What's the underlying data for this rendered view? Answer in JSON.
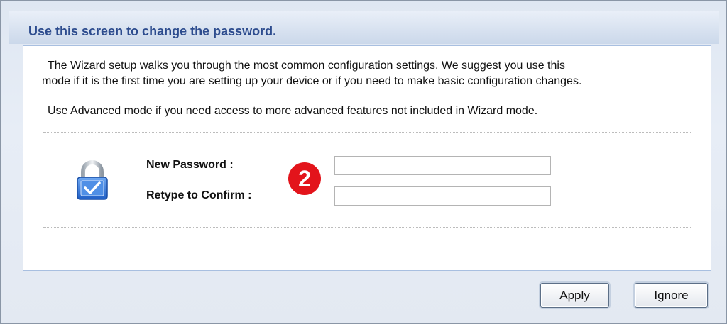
{
  "header": {
    "title": "Use this screen to change the password."
  },
  "intro": {
    "line1": "The Wizard setup walks you through the most common configuration settings. We suggest you use this",
    "line2": "mode if it is the first time you are setting up your device or if you need to make basic configuration changes.",
    "advanced": "Use Advanced mode if you need access to more advanced features not included in Wizard mode."
  },
  "form": {
    "icon": "lock-icon",
    "new_password_label": "New Password :",
    "new_password_value": "",
    "retype_label": "Retype to Confirm :",
    "retype_value": "",
    "step_badge": "2"
  },
  "buttons": {
    "apply": "Apply",
    "ignore": "Ignore"
  },
  "colors": {
    "title": "#2d4c8e",
    "badge": "#e3141b",
    "panel_border": "#a8bfe0"
  }
}
